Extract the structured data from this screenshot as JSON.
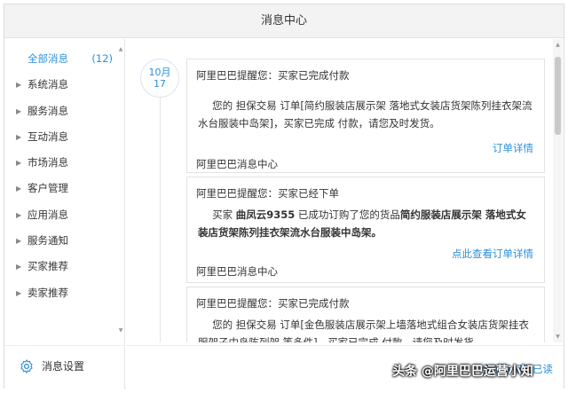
{
  "window": {
    "title": "消息中心"
  },
  "sidebar": {
    "items": [
      {
        "label": "全部消息",
        "count": "(12)",
        "active": true
      },
      {
        "label": "系统消息"
      },
      {
        "label": "服务消息"
      },
      {
        "label": "互动消息"
      },
      {
        "label": "市场消息"
      },
      {
        "label": "客户管理"
      },
      {
        "label": "应用消息"
      },
      {
        "label": "服务通知"
      },
      {
        "label": "买家推荐"
      },
      {
        "label": "卖家推荐"
      }
    ],
    "settings_label": "消息设置"
  },
  "main": {
    "date": {
      "month": "10月",
      "day": "17"
    },
    "messages": [
      {
        "title": "阿里巴巴提醒您：买家已完成付款",
        "body": "您的 担保交易 订单[简约服装店展示架 落地式女装店货架陈列挂衣架流水台服装中岛架]，买家已完成 付款，请您及时发货。",
        "link": "订单详情",
        "sender": "阿里巴巴消息中心"
      },
      {
        "title": "阿里巴巴提醒您：买家已经下单",
        "body_prefix": "买家 ",
        "body_buyer": "曲凤云9355",
        "body_mid": " 已成功订购了您的货品",
        "body_product": "简约服装店展示架 落地式女装店货架陈列挂衣架流水台服装中岛架。",
        "link": "点此查看订单详情",
        "sender": "阿里巴巴消息中心"
      },
      {
        "title": "阿里巴巴提醒您：买家已完成付款",
        "body": "您的 担保交易 订单[金色服装店展示架上墙落地式组合女装店货架挂衣服架子中岛陈列架 等多件]，买家已完成 付款，请您及时发货。"
      }
    ],
    "mark_all_label": "全部标记为已读"
  },
  "watermark": "头条 @阿里巴巴运营小知",
  "colors": {
    "accent": "#2f8fd8",
    "titlebar": "#f3f3f3",
    "border": "#e3e3e3"
  }
}
